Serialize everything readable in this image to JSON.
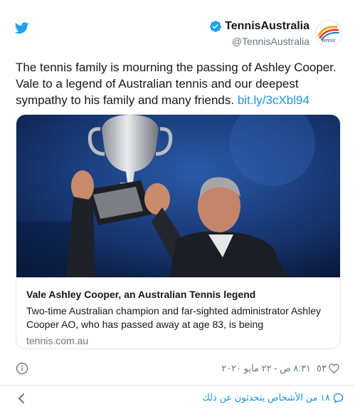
{
  "header": {
    "display_name": "TennisAustralia",
    "handle": "@TennisAustralia"
  },
  "tweet": {
    "text": "The tennis family is mourning the passing of Ashley Cooper. Vale to a legend of Australian tennis and our deepest sympathy to his family and many friends.",
    "link": "bit.ly/3cXbl94"
  },
  "card": {
    "title": "Vale Ashley Cooper, an Australian Tennis legend",
    "description": "Two-time Australian champion and far-sighted administrator Ashley Cooper AO, who has passed away at age 83, is being",
    "domain": "tennis.com.au"
  },
  "footer": {
    "timestamp": "٨:٣١ ص - ٢٢ مايو ٢٠٢٠",
    "like_count": "٥٣",
    "conversation": "١٨ من الأشخاص يتحدثون عن ذلك"
  },
  "colors": {
    "brand_blue": "#1da1f2",
    "link_blue": "#1b95e0",
    "muted": "#657786"
  },
  "icons": [
    "twitter-bird-icon",
    "verified-badge-icon",
    "tennis-australia-logo",
    "info-icon",
    "heart-icon",
    "chevron-left-icon",
    "speech-bubble-icon"
  ]
}
